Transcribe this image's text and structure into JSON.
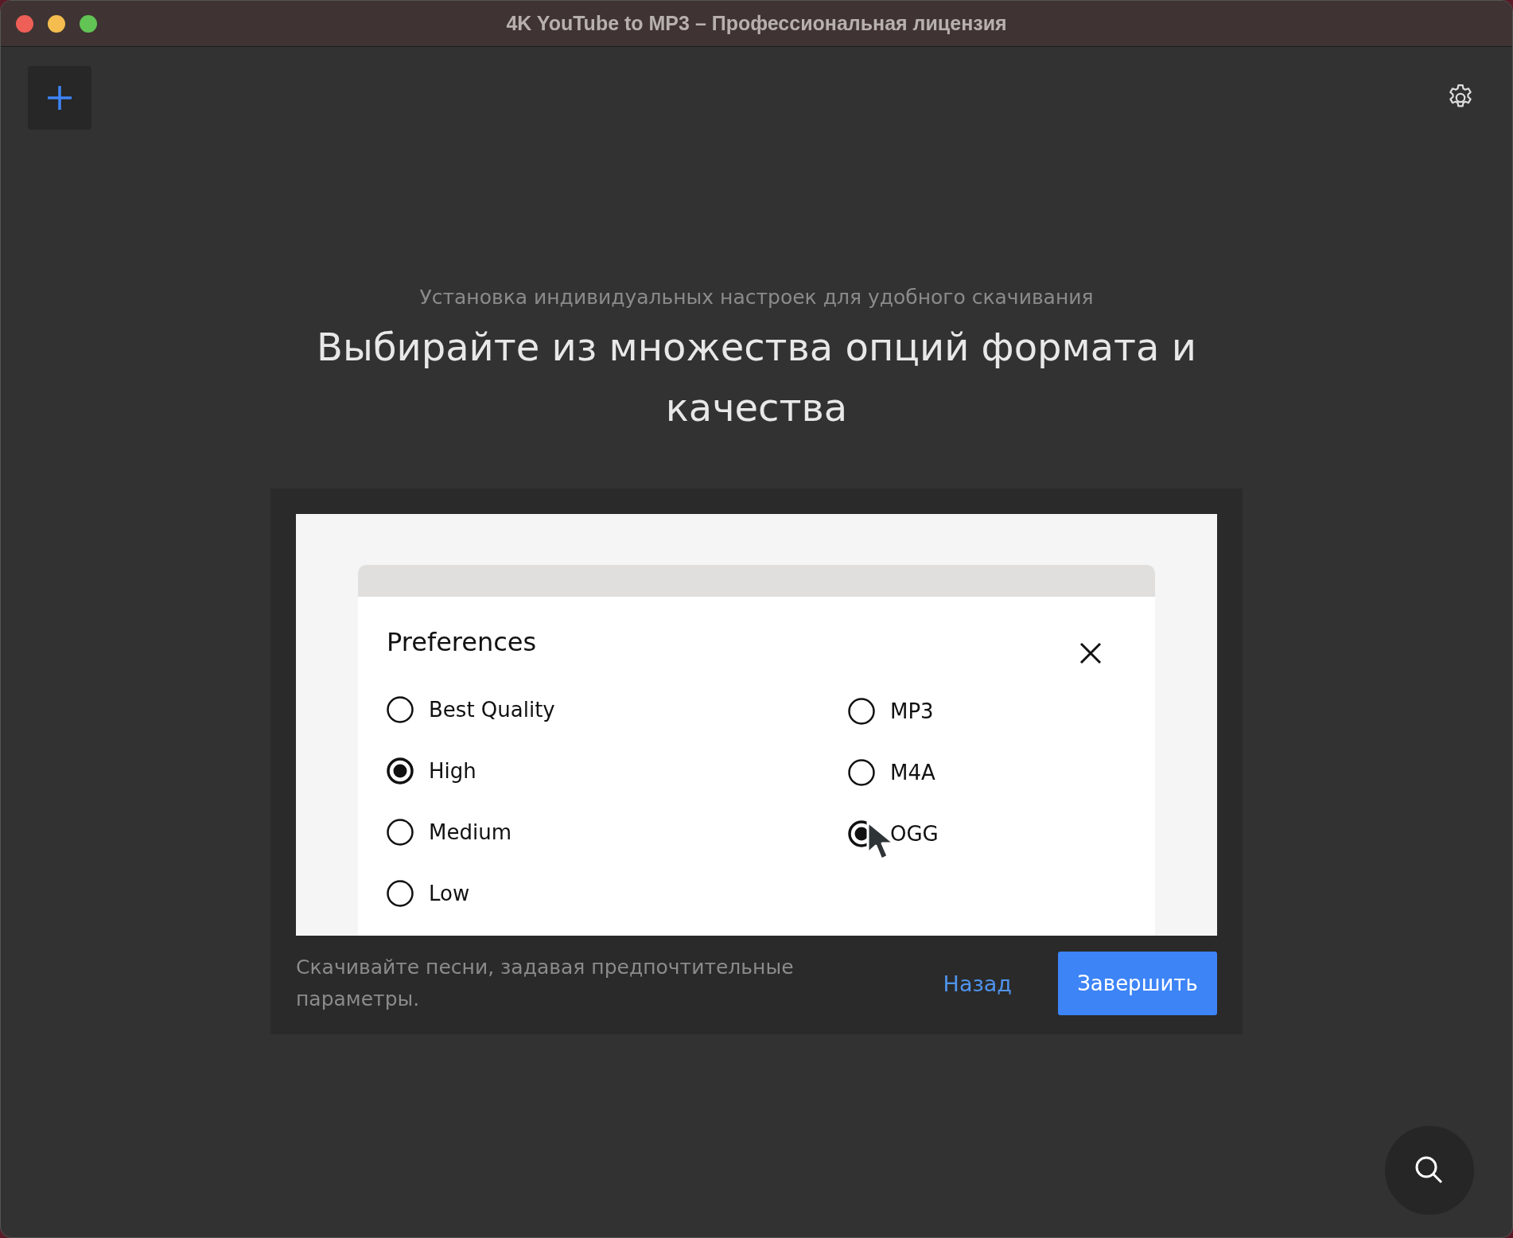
{
  "window": {
    "title": "4K YouTube to MP3 – Профессиональная лицензия"
  },
  "hero": {
    "subtitle": "Установка индивидуальных настроек для удобного скачивания",
    "heading": "Выбирайте из множества опций формата и качества"
  },
  "preview": {
    "dialog_title": "Preferences",
    "quality_options": [
      {
        "label": "Best Quality",
        "selected": false
      },
      {
        "label": "High",
        "selected": true
      },
      {
        "label": "Medium",
        "selected": false
      },
      {
        "label": "Low",
        "selected": false
      }
    ],
    "format_options": [
      {
        "label": "MP3",
        "selected": false
      },
      {
        "label": "M4A",
        "selected": false
      },
      {
        "label": "OGG",
        "selected": true
      }
    ]
  },
  "footer": {
    "description": "Скачивайте песни, задавая предпочтительные параметры.",
    "back_link": "Назад",
    "finish_button": "Завершить"
  }
}
